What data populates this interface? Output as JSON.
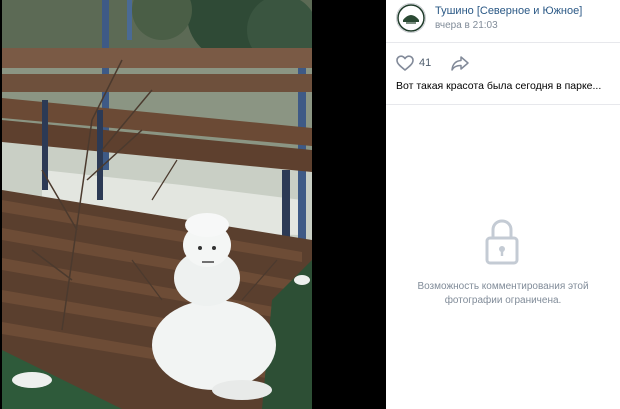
{
  "post": {
    "group_name": "Тушино [Северное и Южное]",
    "time": "вчера в 21:03",
    "likes": "41",
    "caption": "Вот такая красота была сегодня в парке..."
  },
  "comments": {
    "restricted_text": "Возможность комментирования этой фотографии ограничена."
  },
  "icons": {
    "like": "heart-icon",
    "share": "share-arrow-icon",
    "lock": "lock-icon"
  },
  "colors": {
    "link": "#2a5885",
    "secondary": "#818c99",
    "lock": "#c4cbd4"
  }
}
